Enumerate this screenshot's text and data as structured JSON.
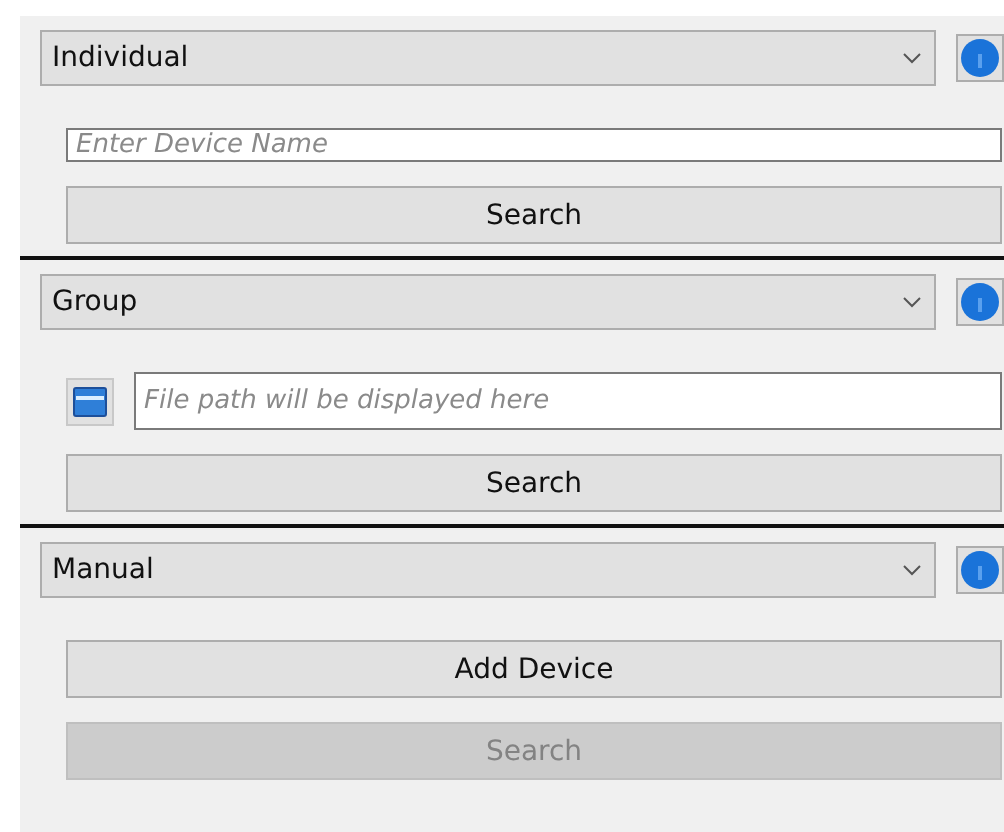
{
  "sections": [
    {
      "dropdown": {
        "value": "Individual"
      },
      "controls": [
        {
          "kind": "text",
          "placeholder": "Enter Device Name"
        },
        {
          "kind": "button",
          "label": "Search",
          "disabled": false
        }
      ]
    },
    {
      "dropdown": {
        "value": "Group"
      },
      "controls": [
        {
          "kind": "file",
          "placeholder": "File path will be displayed here"
        },
        {
          "kind": "button",
          "label": "Search",
          "disabled": false
        }
      ]
    },
    {
      "dropdown": {
        "value": "Manual"
      },
      "controls": [
        {
          "kind": "button",
          "label": "Add Device",
          "disabled": false
        },
        {
          "kind": "button",
          "label": "Search",
          "disabled": true
        }
      ]
    }
  ]
}
